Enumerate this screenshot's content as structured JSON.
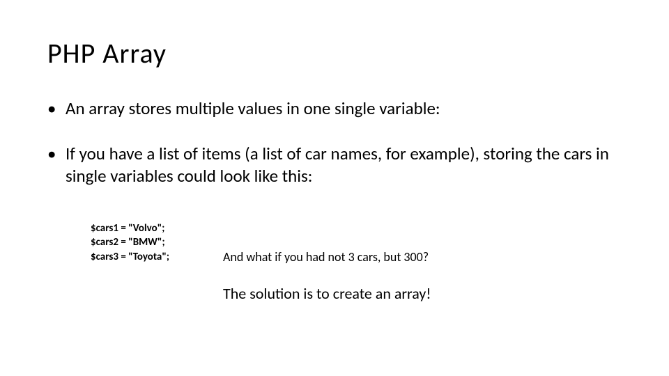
{
  "title": "PHP Array",
  "bullets": [
    "An array stores multiple values in one single variable:",
    "If you have a list of items (a list of car names, for example), storing the cars in single variables could look like this:"
  ],
  "code": {
    "line1": "$cars1 = \"Volvo\";",
    "line2": "$cars2 = \"BMW\";",
    "line3": "$cars3 = \"Toyota\";"
  },
  "note1": "And what if you had not 3 cars, but 300?",
  "note2": "The solution is to create an array!"
}
